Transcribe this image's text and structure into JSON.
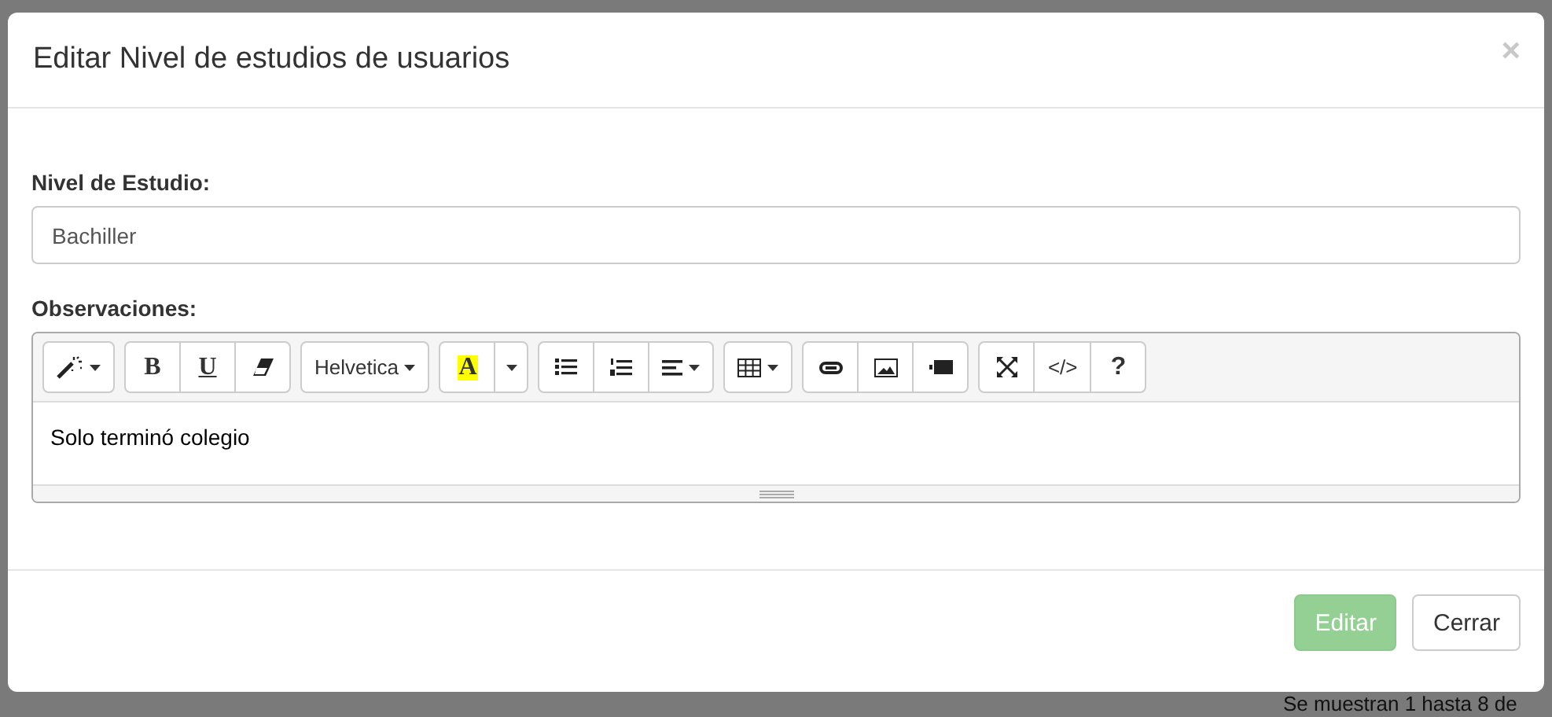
{
  "modal": {
    "title": "Editar Nivel de estudios de usuarios",
    "close": "×",
    "fields": [
      {
        "label": "Nivel de Estudio:",
        "value": "Bachiller"
      }
    ],
    "editor": {
      "label": "Observaciones:",
      "content": "Solo terminó colegio",
      "groups": [
        [
          {
            "kind": "magic",
            "caret": true
          }
        ],
        [
          {
            "kind": "bold",
            "label": "B"
          },
          {
            "kind": "underline",
            "label": "U"
          },
          {
            "kind": "eraser"
          }
        ],
        [
          {
            "kind": "font",
            "label": "Helvetica",
            "caret": true
          }
        ],
        [
          {
            "kind": "color",
            "label": "A"
          },
          {
            "kind": "dropdown",
            "caret": true
          }
        ],
        [
          {
            "kind": "bullets"
          },
          {
            "kind": "numbers"
          },
          {
            "kind": "align",
            "caret": true
          }
        ],
        [
          {
            "kind": "table",
            "caret": true
          }
        ],
        [
          {
            "kind": "link"
          },
          {
            "kind": "image"
          },
          {
            "kind": "video"
          }
        ],
        [
          {
            "kind": "expand"
          },
          {
            "kind": "code",
            "label": "</>"
          },
          {
            "kind": "help",
            "label": "?"
          }
        ]
      ]
    },
    "buttons": [
      {
        "label": "Editar",
        "kind": "primary",
        "disabled": true
      },
      {
        "label": "Cerrar",
        "kind": "default",
        "disabled": false
      }
    ]
  },
  "background_text": "Se muestran 1 hasta 8 de"
}
